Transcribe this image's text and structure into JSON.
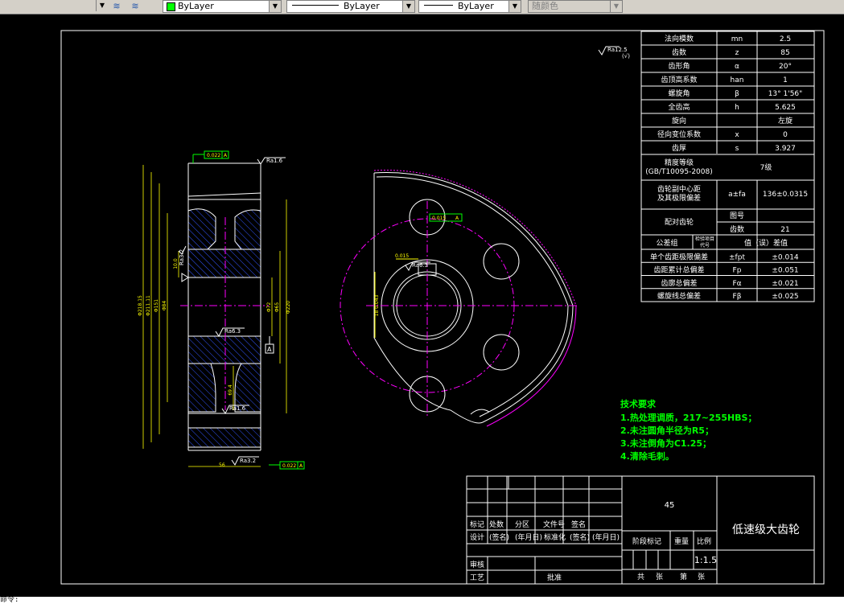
{
  "toolbar": {
    "color_value": "ByLayer",
    "linetype_value": "ByLayer",
    "lineweight_value": "ByLayer",
    "plotstyle_value": "随颜色"
  },
  "params": [
    [
      "法向模数",
      "mn",
      "2.5"
    ],
    [
      "齿数",
      "z",
      "85"
    ],
    [
      "齿形角",
      "α",
      "20°"
    ],
    [
      "齿顶高系数",
      "han",
      "1"
    ],
    [
      "螺旋角",
      "β",
      "13° 1'56\""
    ],
    [
      "全齿高",
      "h",
      "5.625"
    ],
    [
      "旋向",
      "",
      "左旋"
    ],
    [
      "径向变位系数",
      "x",
      "0"
    ],
    [
      "齿厚",
      "s",
      "3.927"
    ]
  ],
  "precision": {
    "label": "精度等级",
    "label2": "(GB/T10095-2008)",
    "value": "7级"
  },
  "center": {
    "label": "齿轮副中心距",
    "label2": "及其极限偏差",
    "sym": "a±fa",
    "value": "136±0.0315"
  },
  "mating": {
    "label": "配对齿轮",
    "r1": "图号",
    "r2": "齿数",
    "r2v": "21"
  },
  "tol_header": [
    "公差组",
    "检验项目",
    "代号",
    "值（误）差值"
  ],
  "tol_rows": [
    [
      "单个齿距极限偏差",
      "±fpt",
      "±0.014"
    ],
    [
      "齿距累计总偏差",
      "Fp",
      "±0.051"
    ],
    [
      "齿廓总偏差",
      "Fα",
      "±0.021"
    ],
    [
      "螺旋线总偏差",
      "Fβ",
      "±0.025"
    ]
  ],
  "tech": {
    "title": "技术要求",
    "items": [
      "1.热处理调质，217~255HBS；",
      "2.未注圆角半径为R5；",
      "3.未注倒角为C1.25；",
      "4.清除毛刺。"
    ]
  },
  "titleblock": {
    "material": "45",
    "name": "低速级大齿轮",
    "scale": "1:1.5",
    "row1": [
      "标记",
      "处数",
      "分区",
      "文件号",
      "签名"
    ],
    "row2": [
      "设计",
      "(签名)",
      "(年月日)",
      "标准化",
      "(签名)",
      "(年月日)"
    ],
    "row2b": [
      "阶段标记",
      "重量",
      "比例"
    ],
    "row3": [
      "审核"
    ],
    "row4": [
      "工艺",
      "批准"
    ],
    "sheet": [
      "共",
      "张",
      "第",
      "张"
    ]
  },
  "dims": {
    "rough_top": "Ra12.5",
    "rough_top2": "(√)",
    "rough_a": "Ra1.6",
    "rough_b": "Ra3.2",
    "rough_c": "Ra6.3",
    "rough_d": "Ra1.6",
    "rough_e": "Ra3.2",
    "rough_f": "Ra6.3",
    "rough_g": "Ra3.2",
    "tol1": "0.022",
    "tol1ref": "A",
    "tol2": "0.022",
    "tol2ref": "A",
    "datum": "A",
    "dim_left1": "Φ218.15",
    "dim_left2": "Φ211.11",
    "dim_left3": "Φ151",
    "dim_left4": "Φ84",
    "dim_right1": "Φ72",
    "dim_right2": "Φ220",
    "dim_bore": "Φ65",
    "dim_width": "56",
    "dim_hub": "10.0",
    "dim_key": "18 0.043",
    "dim_keyw": "69.4",
    "sym_tol": "0.015",
    "sym_ref": "A"
  },
  "command": "命令:"
}
